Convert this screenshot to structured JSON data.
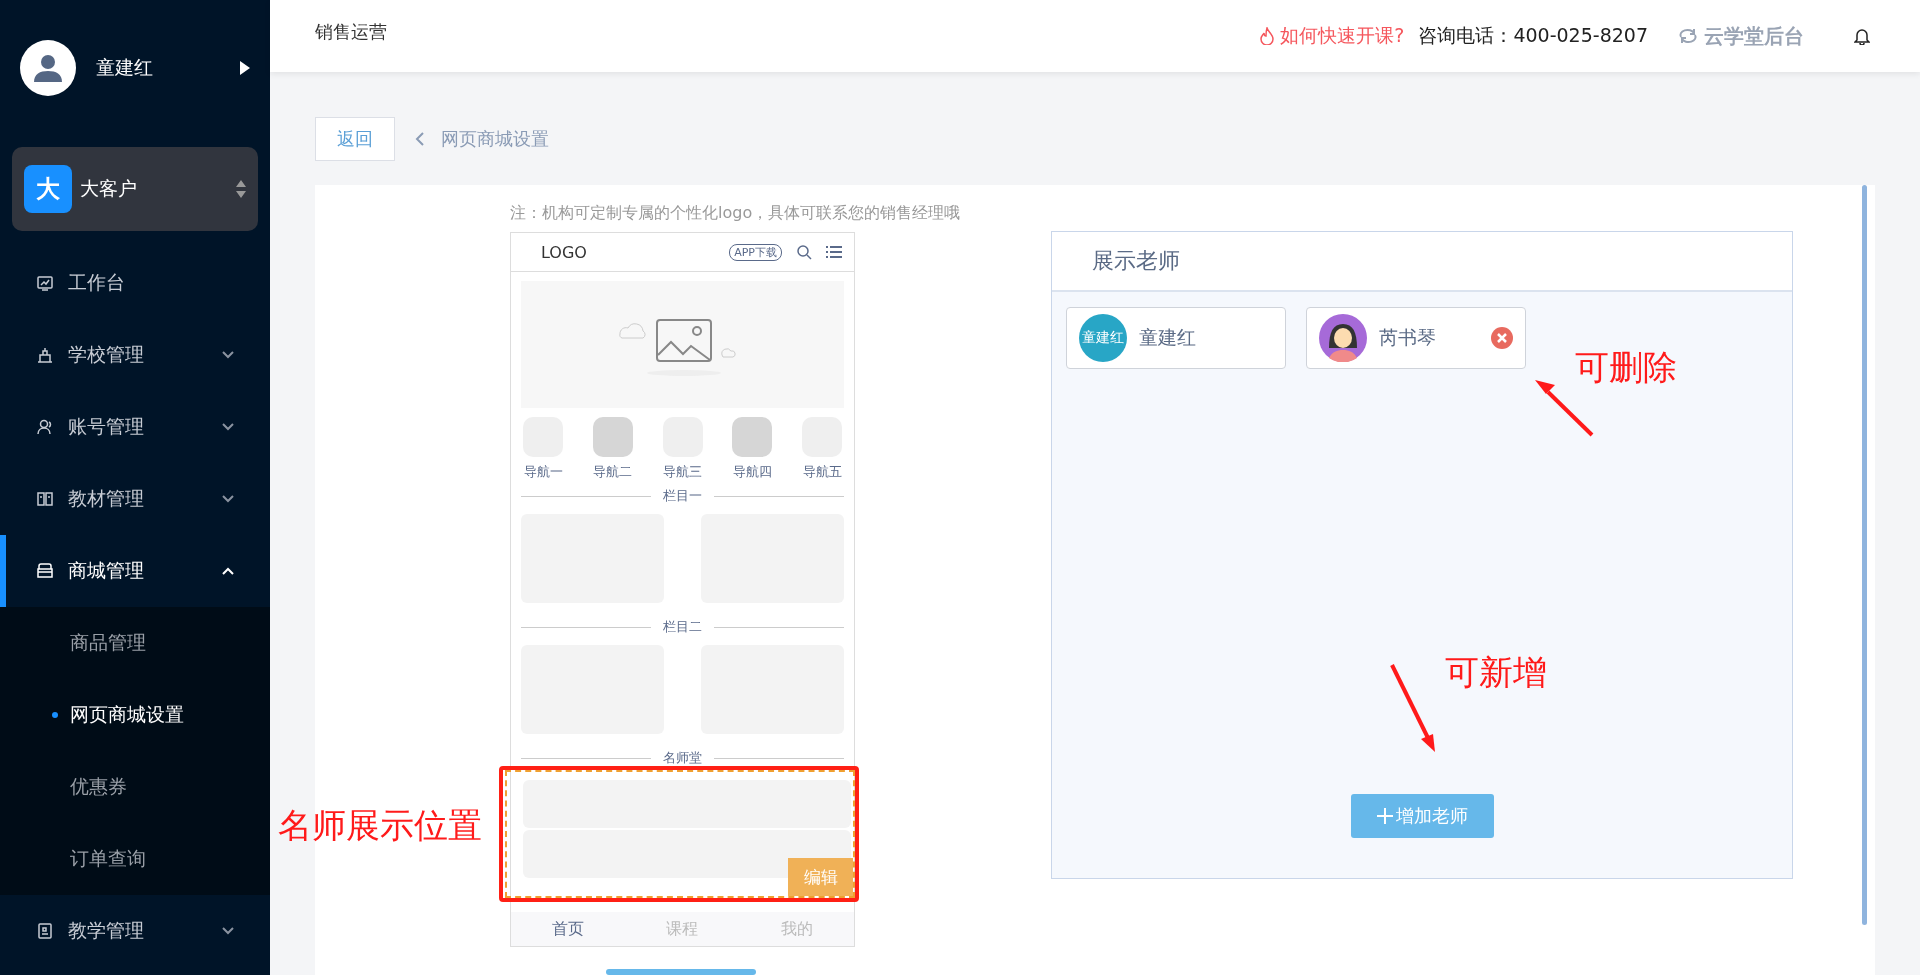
{
  "sidebar": {
    "user": {
      "name": "童建红"
    },
    "org": {
      "badge": "大",
      "name": "大客户"
    },
    "menu": [
      {
        "label": "工作台",
        "kind": "link",
        "selected": false
      },
      {
        "label": "学校管理",
        "kind": "group",
        "expanded": false,
        "selected": false
      },
      {
        "label": "账号管理",
        "kind": "group",
        "expanded": false,
        "selected": false
      },
      {
        "label": "教材管理",
        "kind": "group",
        "expanded": false,
        "selected": false
      },
      {
        "label": "商城管理",
        "kind": "group",
        "expanded": true,
        "selected": true,
        "children": [
          {
            "label": "商品管理",
            "selected": false
          },
          {
            "label": "网页商城设置",
            "selected": true
          },
          {
            "label": "优惠券",
            "selected": false
          },
          {
            "label": "订单查询",
            "selected": false
          }
        ]
      },
      {
        "label": "教学管理",
        "kind": "group",
        "expanded": false,
        "selected": false
      }
    ]
  },
  "header": {
    "title": "销售运营",
    "help_link": "如何快速开课?",
    "phone": "咨询电话：400-025-8207",
    "backend_link": "云学堂后台"
  },
  "breadcrumb": {
    "back_button": "返回",
    "current": "网页商城设置"
  },
  "editor": {
    "note": "注：机构可定制专属的个性化logo，具体可联系您的销售经理哦",
    "phone_preview": {
      "logo": "LOGO",
      "app_badge": "APP下载",
      "nav_items": [
        "导航一",
        "导航二",
        "导航三",
        "导航四",
        "导航五"
      ],
      "sections": [
        "栏目一",
        "栏目二",
        "名师堂"
      ],
      "edit_button": "编辑",
      "tab_bar": [
        {
          "label": "首页",
          "selected": true
        },
        {
          "label": "课程",
          "selected": false
        },
        {
          "label": "我的",
          "selected": false
        }
      ]
    },
    "teacher_panel": {
      "title": "展示老师",
      "teachers": [
        {
          "name": "童建红",
          "kind": "initials",
          "avatar_text": "童建红",
          "removable": false
        },
        {
          "name": "芮书琴",
          "kind": "picture",
          "removable": true
        }
      ],
      "add_button": "增加老师"
    }
  },
  "annotations": [
    {
      "text": "名师展示位置"
    },
    {
      "text": "可删除"
    },
    {
      "text": "可新增"
    }
  ]
}
